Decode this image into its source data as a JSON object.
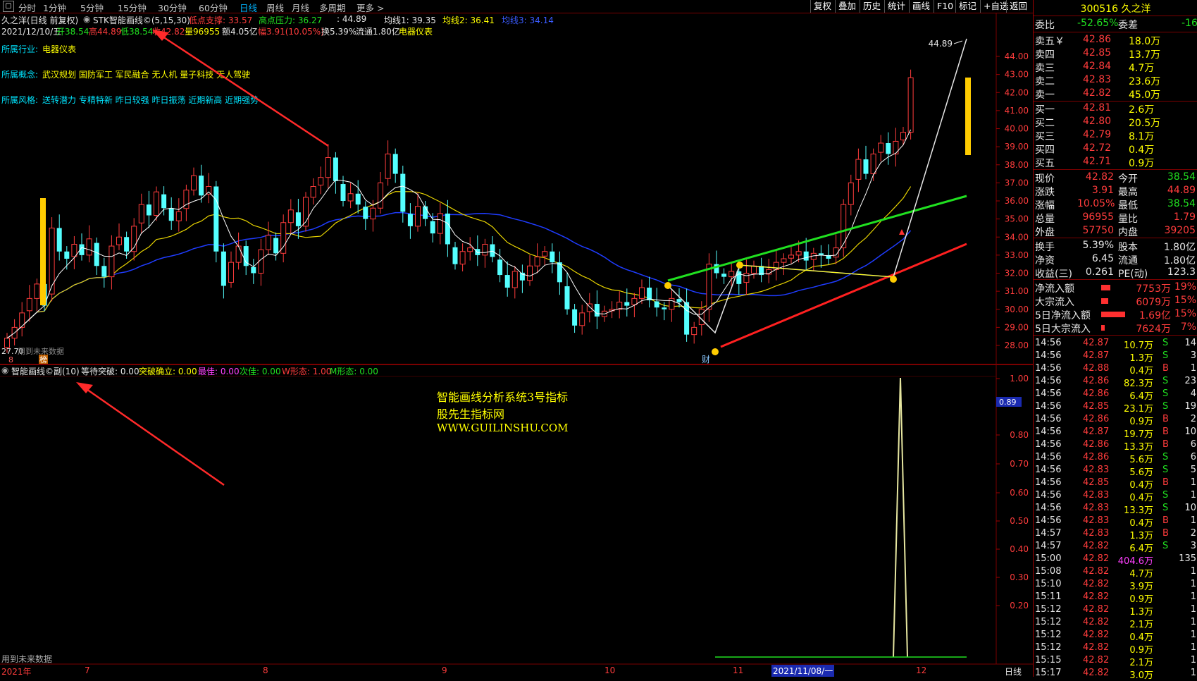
{
  "toolbar": {
    "periods": [
      "分时",
      "1分钟",
      "5分钟",
      "15分钟",
      "30分钟",
      "60分钟",
      "日线",
      "周线",
      "月线",
      "多周期",
      "更多 >"
    ],
    "active_period": "日线",
    "right_tools": [
      "复权",
      "叠加",
      "历史",
      "统计",
      "画线",
      "F10",
      "标记",
      "+自选",
      "返回"
    ]
  },
  "header": {
    "stock_name": "久之洋(日线 前复权)",
    "indicator": "STK智能画线©(5,15,30)",
    "low_support": "低点支撑: 33.57",
    "high_pressure": "高点压力: 36.27",
    "extra_val": ": 44.89",
    "ma1": "均线1: 39.35",
    "ma2": "均线2: 36.41",
    "ma3": "均线3: 34.14"
  },
  "ohlc": {
    "date": "2021/12/10/五",
    "open": "开38.54",
    "high": "高44.89",
    "low": "低38.54",
    "close": "收42.82",
    "volume": "量96955",
    "amount": "额4.05亿",
    "change": "幅3.91(10.05%)",
    "turnover": "换5.39%",
    "float": "流通1.80亿",
    "sector": "电器仪表"
  },
  "tags": {
    "industry_label": "所属行业:",
    "industry": "电器仪表",
    "concept_label": "所属概念:",
    "concept": "武汉规划 国防军工 军民融合 无人机 量子科技 无人驾驶",
    "style_label": "所属风格:",
    "style": "送转潜力 专精特新 昨日较强 昨日振荡 近期新高 近期强势"
  },
  "main_chart": {
    "yticks": [
      "44.00",
      "43.00",
      "42.00",
      "41.00",
      "40.00",
      "39.00",
      "38.00",
      "37.00",
      "36.00",
      "35.00",
      "34.00",
      "33.00",
      "32.00",
      "31.00",
      "30.00",
      "29.00",
      "28.00"
    ],
    "peak_label": "44.89",
    "low_label": "27.70",
    "future_data": "用到未来数据",
    "markers": [
      "8",
      "榜",
      "财"
    ]
  },
  "sub_chart": {
    "title": "智能画线©副(10)",
    "params": [
      {
        "label": "等待突破: 0.00",
        "color": "#e6e6e6"
      },
      {
        "label": "突破确立: 0.00",
        "color": "#ffff00"
      },
      {
        "label": "最佳: 0.00",
        "color": "#ff40ff"
      },
      {
        "label": "次佳: 0.00",
        "color": "#20e020"
      },
      {
        "label": "W形态: 1.00",
        "color": "#ff3c3c"
      },
      {
        "label": "M形态: 0.00",
        "color": "#20e020"
      }
    ],
    "yticks": [
      "1.00",
      "0.80",
      "0.70",
      "0.60",
      "0.50",
      "0.40",
      "0.30",
      "0.20"
    ],
    "current_value": "0.89",
    "watermark": [
      "智能画线分析系统3号指标",
      "股先生指标网",
      "WWW.GUILINSHU.COM"
    ],
    "future_data": "用到未来数据"
  },
  "xaxis": {
    "labels": [
      "2021年",
      "7",
      "8",
      "9",
      "10",
      "11",
      "2021/11/08/一",
      "12"
    ],
    "mode": "日线"
  },
  "panel": {
    "code_name": "300516 久之洋",
    "weibi_label": "委比",
    "weibi": "-52.65%",
    "weicha_label": "委差",
    "weicha": "-16",
    "asks": [
      {
        "label": "卖五￥",
        "price": "42.86",
        "vol": "18.0万"
      },
      {
        "label": "卖四",
        "price": "42.85",
        "vol": "13.7万"
      },
      {
        "label": "卖三",
        "price": "42.84",
        "vol": "4.7万"
      },
      {
        "label": "卖二",
        "price": "42.83",
        "vol": "23.6万"
      },
      {
        "label": "卖一",
        "price": "42.82",
        "vol": "45.0万"
      }
    ],
    "bids": [
      {
        "label": "买一",
        "price": "42.81",
        "vol": "2.6万"
      },
      {
        "label": "买二",
        "price": "42.80",
        "vol": "20.5万"
      },
      {
        "label": "买三",
        "price": "42.79",
        "vol": "8.1万"
      },
      {
        "label": "买四",
        "price": "42.72",
        "vol": "0.4万"
      },
      {
        "label": "买五",
        "price": "42.71",
        "vol": "0.9万"
      }
    ],
    "quote": [
      {
        "l1": "现价",
        "v1": "42.82",
        "l2": "今开",
        "v2": "38.54"
      },
      {
        "l1": "涨跌",
        "v1": "3.91",
        "l2": "最高",
        "v2": "44.89"
      },
      {
        "l1": "涨幅",
        "v1": "10.05%",
        "l2": "最低",
        "v2": "38.54"
      },
      {
        "l1": "总量",
        "v1": "96955",
        "l2": "量比",
        "v2": "1.79"
      },
      {
        "l1": "外盘",
        "v1": "57750",
        "l2": "内盘",
        "v2": "39205"
      }
    ],
    "stats": [
      {
        "l1": "换手",
        "v1": "5.39%",
        "l2": "股本",
        "v2": "1.80亿"
      },
      {
        "l1": "净资",
        "v1": "6.45",
        "l2": "流通",
        "v2": "1.80亿"
      },
      {
        "l1": "收益(三)",
        "v1": "0.261",
        "l2": "PE(动)",
        "v2": "123.3"
      }
    ],
    "flows": [
      {
        "label": "净流入额",
        "value": "7753万",
        "pct": "19%",
        "bar": 0.19
      },
      {
        "label": "大宗流入",
        "value": "6079万",
        "pct": "15%",
        "bar": 0.15
      },
      {
        "label": "5日净流入额",
        "value": "1.69亿",
        "pct": "15%",
        "bar": 0.5
      },
      {
        "label": "5日大宗流入",
        "value": "7624万",
        "pct": "7%",
        "bar": 0.07
      }
    ],
    "ticks": [
      {
        "t": "14:56",
        "p": "42.87",
        "v": "10.7万",
        "s": "S",
        "n": "14"
      },
      {
        "t": "14:56",
        "p": "42.87",
        "v": "1.3万",
        "s": "S",
        "n": "3"
      },
      {
        "t": "14:56",
        "p": "42.88",
        "v": "0.4万",
        "s": "B",
        "n": "1"
      },
      {
        "t": "14:56",
        "p": "42.86",
        "v": "82.3万",
        "s": "S",
        "n": "23"
      },
      {
        "t": "14:56",
        "p": "42.86",
        "v": "6.4万",
        "s": "S",
        "n": "4"
      },
      {
        "t": "14:56",
        "p": "42.85",
        "v": "23.1万",
        "s": "S",
        "n": "19"
      },
      {
        "t": "14:56",
        "p": "42.86",
        "v": "0.9万",
        "s": "B",
        "n": "2"
      },
      {
        "t": "14:56",
        "p": "42.87",
        "v": "19.7万",
        "s": "B",
        "n": "10"
      },
      {
        "t": "14:56",
        "p": "42.86",
        "v": "13.3万",
        "s": "B",
        "n": "6"
      },
      {
        "t": "14:56",
        "p": "42.86",
        "v": "5.6万",
        "s": "S",
        "n": "6"
      },
      {
        "t": "14:56",
        "p": "42.83",
        "v": "5.6万",
        "s": "S",
        "n": "5"
      },
      {
        "t": "14:56",
        "p": "42.85",
        "v": "0.4万",
        "s": "B",
        "n": "1"
      },
      {
        "t": "14:56",
        "p": "42.83",
        "v": "0.4万",
        "s": "S",
        "n": "1"
      },
      {
        "t": "14:56",
        "p": "42.83",
        "v": "13.3万",
        "s": "S",
        "n": "10"
      },
      {
        "t": "14:56",
        "p": "42.83",
        "v": "0.4万",
        "s": "B",
        "n": "1"
      },
      {
        "t": "14:57",
        "p": "42.83",
        "v": "1.3万",
        "s": "B",
        "n": "2"
      },
      {
        "t": "14:57",
        "p": "42.82",
        "v": "6.4万",
        "s": "S",
        "n": "3"
      },
      {
        "t": "15:00",
        "p": "42.82",
        "v": "404.6万",
        "s": "",
        "n": "135"
      },
      {
        "t": "15:08",
        "p": "42.82",
        "v": "4.7万",
        "s": "",
        "n": "1"
      },
      {
        "t": "15:10",
        "p": "42.82",
        "v": "3.9万",
        "s": "",
        "n": "1"
      },
      {
        "t": "15:11",
        "p": "42.82",
        "v": "0.9万",
        "s": "",
        "n": "1"
      },
      {
        "t": "15:12",
        "p": "42.82",
        "v": "1.3万",
        "s": "",
        "n": "1"
      },
      {
        "t": "15:12",
        "p": "42.82",
        "v": "2.1万",
        "s": "",
        "n": "1"
      },
      {
        "t": "15:12",
        "p": "42.82",
        "v": "0.4万",
        "s": "",
        "n": "1"
      },
      {
        "t": "15:12",
        "p": "42.82",
        "v": "0.9万",
        "s": "",
        "n": "1"
      },
      {
        "t": "15:15",
        "p": "42.82",
        "v": "2.1万",
        "s": "",
        "n": "1"
      },
      {
        "t": "15:17",
        "p": "42.82",
        "v": "3.0万",
        "s": "",
        "n": "1"
      }
    ]
  },
  "colors": {
    "up": "#ff3c3c",
    "down": "#54ffff",
    "ma_white": "#ffffff",
    "ma_yellow": "#e6d200",
    "ma_blue": "#1f3cff",
    "support": "#ff2020",
    "resistance": "#20e020",
    "accent_panel": "#ffff00"
  }
}
